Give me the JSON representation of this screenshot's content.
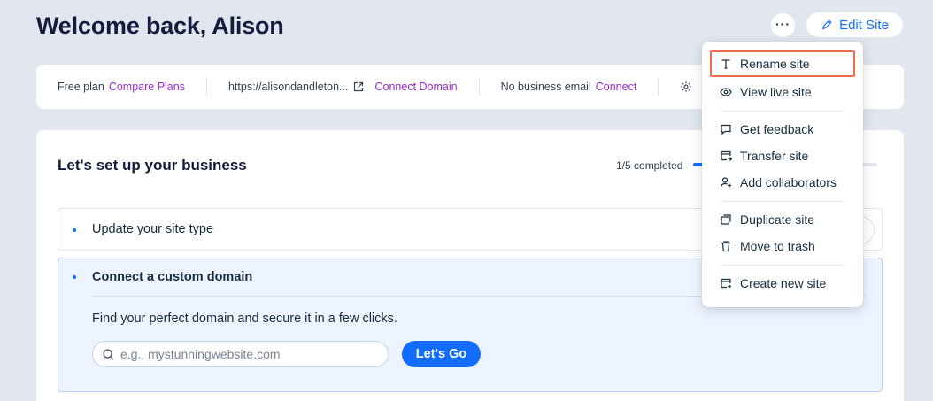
{
  "header": {
    "title": "Welcome back, Alison",
    "more_label": "···",
    "edit_label": "Edit Site"
  },
  "info_bar": {
    "plan_text": "Free plan",
    "compare_label": "Compare Plans",
    "url_text": "https://alisondandleton...",
    "connect_domain_label": "Connect Domain",
    "email_text": "No business email",
    "connect_label": "Connect"
  },
  "setup": {
    "title": "Let's set up your business",
    "progress_text": "1/5 completed",
    "progress_fraction": 0.2,
    "tasks": [
      {
        "label": "Update your site type"
      },
      {
        "label": "Connect a custom domain",
        "description": "Find your perfect domain and secure it in a few clicks.",
        "search_placeholder": "e.g., mystunningwebsite.com",
        "button_label": "Let's Go"
      }
    ]
  },
  "menu": {
    "items": [
      {
        "label": "Rename site",
        "icon": "text-icon",
        "highlighted": true
      },
      {
        "label": "View live site",
        "icon": "eye-icon"
      },
      {
        "label": "Get feedback",
        "icon": "comment-icon"
      },
      {
        "label": "Transfer site",
        "icon": "transfer-icon"
      },
      {
        "label": "Add collaborators",
        "icon": "add-user-icon"
      },
      {
        "label": "Duplicate site",
        "icon": "duplicate-icon"
      },
      {
        "label": "Move to trash",
        "icon": "trash-icon"
      },
      {
        "label": "Create new site",
        "icon": "new-site-icon"
      }
    ]
  },
  "colors": {
    "primary": "#116dff",
    "link_purple": "#9a27d5",
    "highlight": "#ef6c4a",
    "background": "#e2e6ee"
  }
}
